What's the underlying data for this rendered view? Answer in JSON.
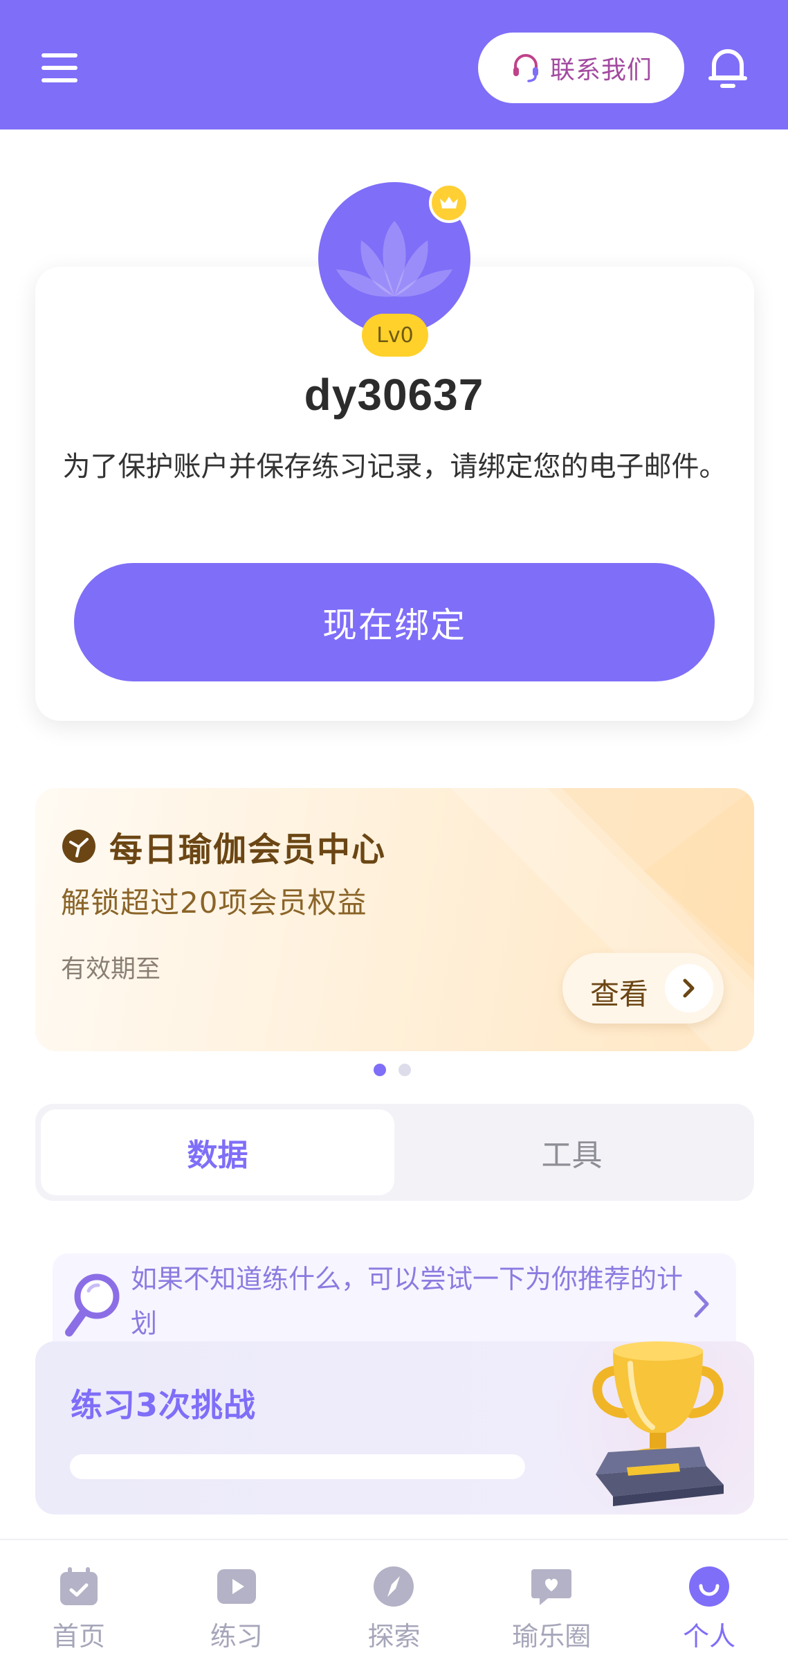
{
  "header": {
    "contact_label": "联系我们"
  },
  "profile": {
    "level": "Lv0",
    "username": "dy30637",
    "notice": "为了保护账户并保存练习记录，请绑定您的电子邮件。",
    "bind_button": "现在绑定"
  },
  "membership": {
    "title": "每日瑜伽会员中心",
    "subtitle": "解锁超过20项会员权益",
    "expiry_label": "有效期至",
    "view_button": "查看",
    "carousel_pages": 2,
    "carousel_active": 1
  },
  "tabs": {
    "items": [
      {
        "label": "数据",
        "active": true
      },
      {
        "label": "工具",
        "active": false
      }
    ]
  },
  "recommendation": {
    "text": "如果不知道练什么，可以尝试一下为你推荐的计划"
  },
  "challenge": {
    "title": "练习3次挑战",
    "progress": 0
  },
  "bottom_nav": {
    "items": [
      {
        "label": "首页",
        "icon": "calendar-check-icon",
        "active": false
      },
      {
        "label": "练习",
        "icon": "play-icon",
        "active": false
      },
      {
        "label": "探索",
        "icon": "compass-icon",
        "active": false
      },
      {
        "label": "瑜乐圈",
        "icon": "chat-heart-icon",
        "active": false
      },
      {
        "label": "个人",
        "icon": "profile-smile-icon",
        "active": true
      }
    ]
  },
  "colors": {
    "primary": "#7f6ef8",
    "gold": "#ffd12a",
    "member_text": "#6b4614",
    "inactive_nav": "#a6a6ba"
  }
}
